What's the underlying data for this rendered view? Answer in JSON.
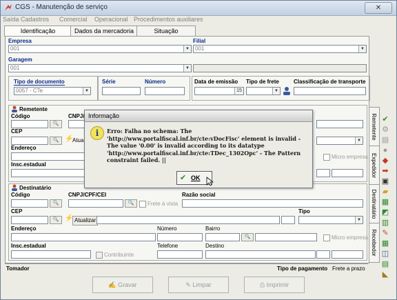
{
  "window": {
    "title": "CGS - Manutenção de serviço",
    "close": "✕"
  },
  "menu": [
    "Saída",
    "Cadastros",
    "Comercial",
    "Operacional",
    "Procedimentos auxiliares"
  ],
  "tabs": [
    "Identificação",
    "Dados da mercadoria",
    "Situação"
  ],
  "top": {
    "empresa_label": "Empresa",
    "empresa_value": "001",
    "filial_label": "Filial",
    "filial_value": "001",
    "garagem_label": "Garagem",
    "garagem_value": "001",
    "tipo_doc_label": "Tipo de documento",
    "tipo_doc_value": "0057 - CTe",
    "serie_label": "Série",
    "serie_value": "",
    "numero_label": "Número",
    "numero_value": "",
    "data_emissao_label": "Data de emissão",
    "data_emissao_btn": "15",
    "tipo_frete_label": "Tipo de frete",
    "classificacao_label": "Classificação de transporte"
  },
  "remetente": {
    "title": "Remetente",
    "codigo": "Código",
    "cnpj": "CNPJ/",
    "cep": "CEP",
    "atualizar": "Atual",
    "endereco": "Endereço",
    "insc": "Insc.estadual",
    "micro": "Micro empresa"
  },
  "destinatario": {
    "title": "Destinatário",
    "codigo": "Código",
    "cnpj": "CNPJ/CPF/CEI",
    "frete_vista": "Frete à vista",
    "razao": "Razão social",
    "cep": "CEP",
    "tipo": "Tipo",
    "atualizar": "Atualizar",
    "endereco": "Endereço",
    "numero": "Número",
    "bairro": "Bairro",
    "micro": "Micro empresa",
    "insc": "Insc.estadual",
    "contribuinte": "Contribuinte",
    "telefone": "Telefone",
    "destino": "Destino"
  },
  "side_tabs": [
    "Remetente",
    "Expedidor",
    "Destinatário",
    "Recebedor"
  ],
  "footer": {
    "tomador": "Tomador",
    "tipo_pagamento_label": "Tipo de pagamento",
    "tipo_pagamento_value": "Frete a prazo",
    "gravar": "Gravar",
    "limpar": "Limpar",
    "imprimir": "Imprimir"
  },
  "dialog": {
    "title": "Informação",
    "message": "Erro: Falha no schema: The 'http://www.portalfiscal.inf.br/cte:vDocFisc' element is invalid - The value '0.00' is invalid according to its datatype 'http://www.portalfiscal.inf.br/cte:TDec_1302Opc' - The Pattern constraint failed. ||",
    "ok": "OK"
  },
  "icons": {
    "accent": "#0b2a8a",
    "ok_check": "#2e8b2e"
  }
}
